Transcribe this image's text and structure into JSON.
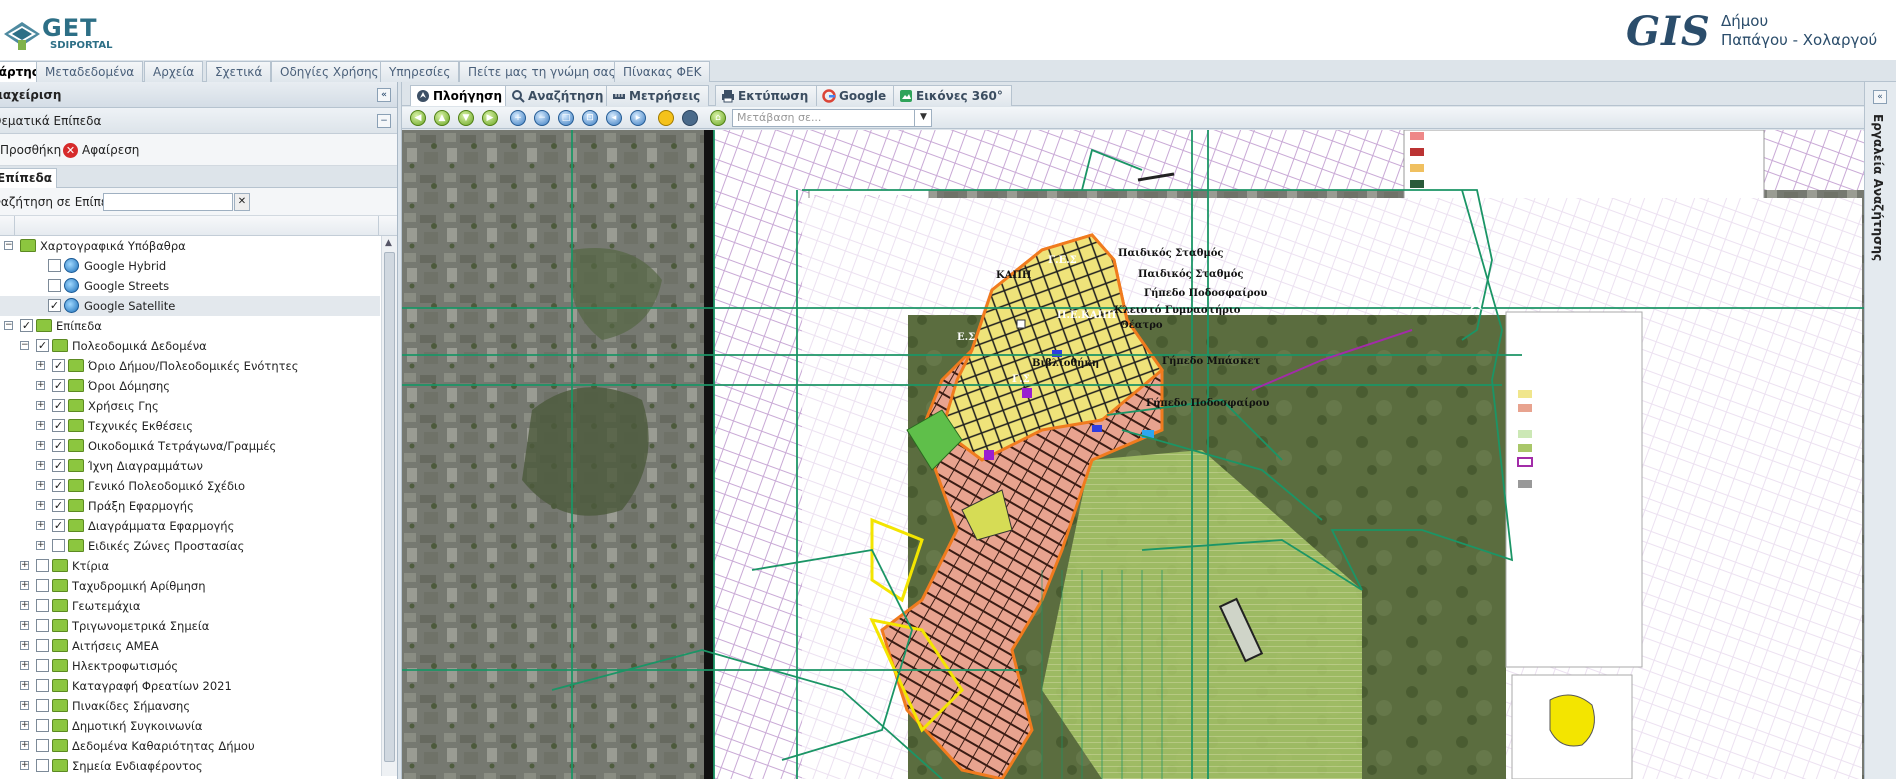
{
  "header": {
    "logo_left_text": "GET",
    "logo_left_sub": "SDIPORTAL",
    "logo_right_text": "GIS",
    "municipality_line1": "Δήμου",
    "municipality_line2": "Παπάγου - Χολαργού"
  },
  "top_tabs": [
    "χάρτης",
    "Μεταδεδομένα",
    "Αρχεία",
    "Σχετικά",
    "Οδηγίες Χρήσης",
    "Υπηρεσίες",
    "Πείτε μας τη γνώμη σας",
    "Πίνακας ΦΕΚ"
  ],
  "left_panel": {
    "title": "διαχείριση",
    "subtitle": "Θεματικά Επίπεδα",
    "add_label": "Προσθήκη",
    "remove_label": "Αφαίρεση",
    "tab_label": "Επίπεδα",
    "search_label": "Αναζήτηση σε Επίπεδα:",
    "search_value": "",
    "tree": [
      {
        "label": "Χαρτογραφικά Υπόβαθρα",
        "level": 0,
        "expander": "−",
        "checkbox": false,
        "icon": "folder"
      },
      {
        "label": "Google Hybrid",
        "level": 1,
        "expander": "",
        "checkbox": true,
        "checked": false,
        "icon": "globe"
      },
      {
        "label": "Google Streets",
        "level": 1,
        "expander": "",
        "checkbox": true,
        "checked": false,
        "icon": "globe"
      },
      {
        "label": "Google Satellite",
        "level": 1,
        "expander": "",
        "checkbox": true,
        "checked": true,
        "icon": "globe",
        "selected": true
      },
      {
        "label": "Επίπεδα",
        "level": 0,
        "expander": "−",
        "checkbox": true,
        "checked": true,
        "icon": "folder"
      },
      {
        "label": "Πολεοδομικά Δεδομένα",
        "level": 1,
        "expander": "−",
        "checkbox": true,
        "checked": true,
        "icon": "folder"
      },
      {
        "label": "Όριο Δήμου/Πολεοδομικές Ενότητες",
        "level": 2,
        "expander": "+",
        "checkbox": true,
        "checked": true,
        "icon": "folder"
      },
      {
        "label": "Όροι Δόμησης",
        "level": 2,
        "expander": "+",
        "checkbox": true,
        "checked": true,
        "icon": "folder"
      },
      {
        "label": "Χρήσεις Γης",
        "level": 2,
        "expander": "+",
        "checkbox": true,
        "checked": true,
        "icon": "folder"
      },
      {
        "label": "Τεχνικές Εκθέσεις",
        "level": 2,
        "expander": "+",
        "checkbox": true,
        "checked": true,
        "icon": "folder"
      },
      {
        "label": "Οικοδομικά Τετράγωνα/Γραμμές",
        "level": 2,
        "expander": "+",
        "checkbox": true,
        "checked": true,
        "icon": "folder"
      },
      {
        "label": "Ίχνη Διαγραμμάτων",
        "level": 2,
        "expander": "+",
        "checkbox": true,
        "checked": true,
        "icon": "folder"
      },
      {
        "label": "Γενικό Πολεοδομικό Σχέδιο",
        "level": 2,
        "expander": "+",
        "checkbox": true,
        "checked": true,
        "icon": "folder"
      },
      {
        "label": "Πράξη Εφαρμογής",
        "level": 2,
        "expander": "+",
        "checkbox": true,
        "checked": true,
        "icon": "folder"
      },
      {
        "label": "Διαγράμματα Εφαρμογής",
        "level": 2,
        "expander": "+",
        "checkbox": true,
        "checked": true,
        "icon": "folder"
      },
      {
        "label": "Ειδικές Ζώνες Προστασίας",
        "level": 2,
        "expander": "+",
        "checkbox": true,
        "checked": false,
        "icon": "folder"
      },
      {
        "label": "Κτίρια",
        "level": 1,
        "expander": "+",
        "checkbox": true,
        "checked": false,
        "icon": "folder"
      },
      {
        "label": "Ταχυδρομική Αρίθμηση",
        "level": 1,
        "expander": "+",
        "checkbox": true,
        "checked": false,
        "icon": "folder"
      },
      {
        "label": "Γεωτεμάχια",
        "level": 1,
        "expander": "+",
        "checkbox": true,
        "checked": false,
        "icon": "folder"
      },
      {
        "label": "Τριγωνομετρικά Σημεία",
        "level": 1,
        "expander": "+",
        "checkbox": true,
        "checked": false,
        "icon": "folder"
      },
      {
        "label": "Αιτήσεις ΑΜΕΑ",
        "level": 1,
        "expander": "+",
        "checkbox": true,
        "checked": false,
        "icon": "folder"
      },
      {
        "label": "Ηλεκτροφωτισμός",
        "level": 1,
        "expander": "+",
        "checkbox": true,
        "checked": false,
        "icon": "folder"
      },
      {
        "label": "Καταγραφή Φρεατίων 2021",
        "level": 1,
        "expander": "+",
        "checkbox": true,
        "checked": false,
        "icon": "folder"
      },
      {
        "label": "Πινακίδες Σήμανσης",
        "level": 1,
        "expander": "+",
        "checkbox": true,
        "checked": false,
        "icon": "folder"
      },
      {
        "label": "Δημοτική Συγκοινωνία",
        "level": 1,
        "expander": "+",
        "checkbox": true,
        "checked": false,
        "icon": "folder"
      },
      {
        "label": "Δεδομένα Καθαριότητας Δήμου",
        "level": 1,
        "expander": "+",
        "checkbox": true,
        "checked": false,
        "icon": "folder"
      },
      {
        "label": "Σημεία Ενδιαφέροντος",
        "level": 1,
        "expander": "+",
        "checkbox": true,
        "checked": false,
        "icon": "folder"
      }
    ]
  },
  "main_tabs": [
    {
      "label": "Πλοήγηση",
      "icon": "navigation-icon",
      "active": true
    },
    {
      "label": "Αναζήτηση",
      "icon": "search-icon",
      "active": false
    },
    {
      "label": "Μετρήσεις",
      "icon": "ruler-icon",
      "active": false
    },
    {
      "label": "Εκτύπωση",
      "icon": "printer-icon",
      "active": false
    },
    {
      "label": "Google",
      "icon": "google-icon",
      "active": false
    },
    {
      "label": "Εικόνες 360°",
      "icon": "panorama-icon",
      "active": false
    }
  ],
  "toolbar": {
    "goto_placeholder": "Μετάβαση σε..."
  },
  "map_labels": [
    "Παιδικός Σταθμός",
    "Παιδικός Σταθμός",
    "Γήπεδο Ποδοσφαίρου",
    "Κλειστό Γυμναστήριο",
    "Θέατρο",
    "Βιβλιοθήκη",
    "Γήπεδο Μπάσκετ",
    "Γήπεδο Ποδοσφαίρου",
    "ΚΑΠΗ",
    "Γ.Ε.Σ",
    "Π.Ε.ΚΑΠΗ",
    "Ε.Σ",
    "Γ.Σ"
  ],
  "right_panel": {
    "title": "Εργαλεία Αναζήτησης"
  },
  "colors": {
    "accent": "#2d6f86",
    "tab_bg": "#dde4ea",
    "border": "#b6c3cf",
    "folder": "#8cc63f"
  }
}
